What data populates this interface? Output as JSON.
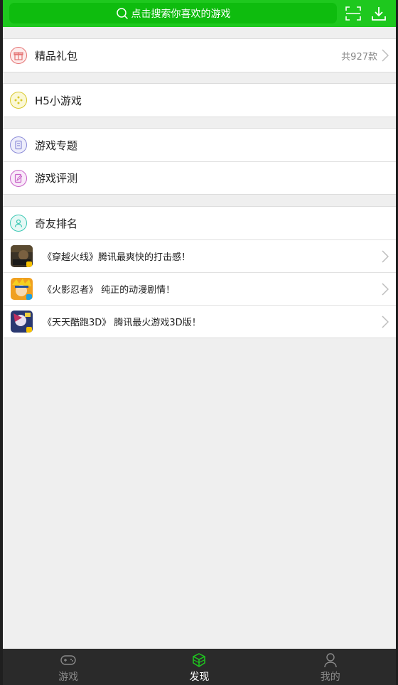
{
  "header": {
    "search_placeholder": "点击搜索你喜欢的游戏",
    "scan_icon": "scan-icon",
    "download_icon": "download-icon",
    "accent": "#1ec81e"
  },
  "sections": {
    "gift": {
      "label": "精品礼包",
      "count": "共927款",
      "icon": "gift-icon",
      "color": "#e57373"
    },
    "h5": {
      "label": "H5小游戏",
      "icon": "gamepad-icon",
      "color": "#d8c82a"
    },
    "topic": {
      "label": "游戏专题",
      "icon": "document-icon",
      "color": "#8c8cd8"
    },
    "review": {
      "label": "游戏评测",
      "icon": "edit-icon",
      "color": "#c862c8"
    },
    "ranking": {
      "label": "奇友排名",
      "icon": "user-icon",
      "color": "#3cc8b4"
    }
  },
  "games": [
    {
      "title": "《穿越火线》腾讯最爽快的打击感！"
    },
    {
      "title": "《火影忍者》 纯正的动漫剧情！"
    },
    {
      "title": "《天天酷跑3D》 腾讯最火游戏3D版！"
    }
  ],
  "nav": {
    "items": [
      {
        "label": "游戏",
        "icon": "gamepad-icon",
        "active": false
      },
      {
        "label": "发现",
        "icon": "cube-icon",
        "active": true
      },
      {
        "label": "我的",
        "icon": "person-icon",
        "active": false
      }
    ]
  }
}
